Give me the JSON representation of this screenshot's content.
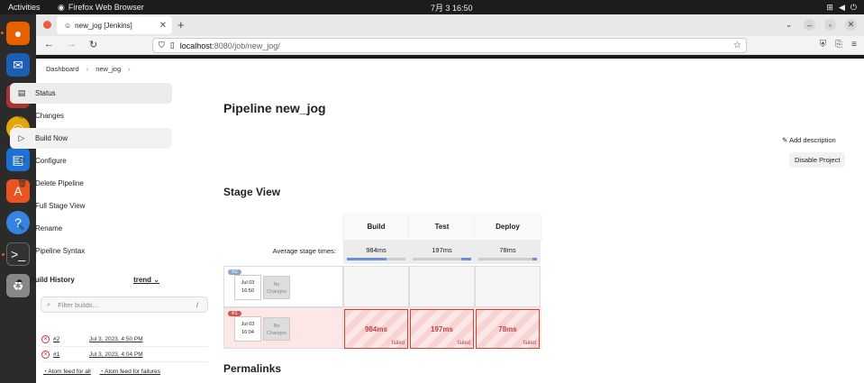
{
  "system": {
    "activities": "Activities",
    "app_name": "Firefox Web Browser",
    "clock": "7月 3  16:50"
  },
  "browser": {
    "tab_title": "new_jog [Jenkins]",
    "url_host": "localhost",
    "url_path": ":8080/job/new_jog/"
  },
  "breadcrumb": {
    "dashboard": "Dashboard",
    "job": "new_jog"
  },
  "sidebar": {
    "items": [
      {
        "label": "Status",
        "icon": "status-icon"
      },
      {
        "label": "Changes",
        "icon": "code-icon"
      },
      {
        "label": "Build Now",
        "icon": "play-icon"
      },
      {
        "label": "Configure",
        "icon": "gear-icon"
      },
      {
        "label": "Delete Pipeline",
        "icon": "trash-icon"
      },
      {
        "label": "Full Stage View",
        "icon": "search-icon"
      },
      {
        "label": "Rename",
        "icon": "pencil-icon"
      },
      {
        "label": "Pipeline Syntax",
        "icon": "help-icon"
      }
    ]
  },
  "build_history": {
    "title": "Build History",
    "trend": "trend",
    "filter_placeholder": "Filter builds...",
    "filter_shortcut": "/",
    "builds": [
      {
        "num": "#2",
        "date": "Jul 3, 2023, 4:50 PM",
        "status": "failed"
      },
      {
        "num": "#1",
        "date": "Jul 3, 2023, 4:04 PM",
        "status": "failed"
      }
    ],
    "feed_all": "Atom feed for all",
    "feed_failures": "Atom feed for failures"
  },
  "main": {
    "title": "Pipeline new_jog",
    "add_description": "Add description",
    "disable_project": "Disable Project",
    "stage_view_title": "Stage View",
    "permalinks_title": "Permalinks"
  },
  "stage_view": {
    "stages": [
      "Build",
      "Test",
      "Deploy"
    ],
    "avg_label": "Average stage times:",
    "avg_times": [
      "984ms",
      "197ms",
      "78ms"
    ],
    "avg_fill": [
      0.68,
      0.17,
      0.07
    ],
    "runs": [
      {
        "badge": "#2",
        "date": "Jul 03",
        "time": "16:50",
        "changes": "No Changes",
        "cells": []
      },
      {
        "badge": "#1",
        "date": "Jul 03",
        "time": "16:04",
        "changes": "No Changes",
        "cells": [
          "984ms",
          "197ms",
          "78ms"
        ],
        "cell_status": "failed"
      }
    ]
  }
}
